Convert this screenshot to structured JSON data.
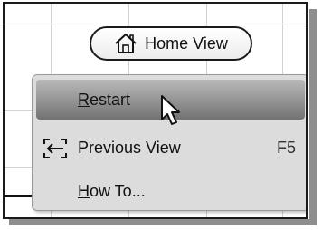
{
  "home_button": {
    "label": "Home View",
    "icon": "house-icon"
  },
  "menu": {
    "items": [
      {
        "mnemonic": "R",
        "rest": "estart",
        "shortcut": "",
        "icon": "",
        "highlighted": true
      },
      {
        "mnemonic": "",
        "rest": "Previous View",
        "shortcut": "F5",
        "icon": "previous-view-icon",
        "highlighted": false
      },
      {
        "mnemonic": "H",
        "rest": "ow To...",
        "shortcut": "",
        "icon": "",
        "highlighted": false
      }
    ]
  },
  "colors": {
    "highlight_top": "#b9b9b9",
    "highlight_bottom": "#727272",
    "menu_background": "#dcdcdc"
  }
}
